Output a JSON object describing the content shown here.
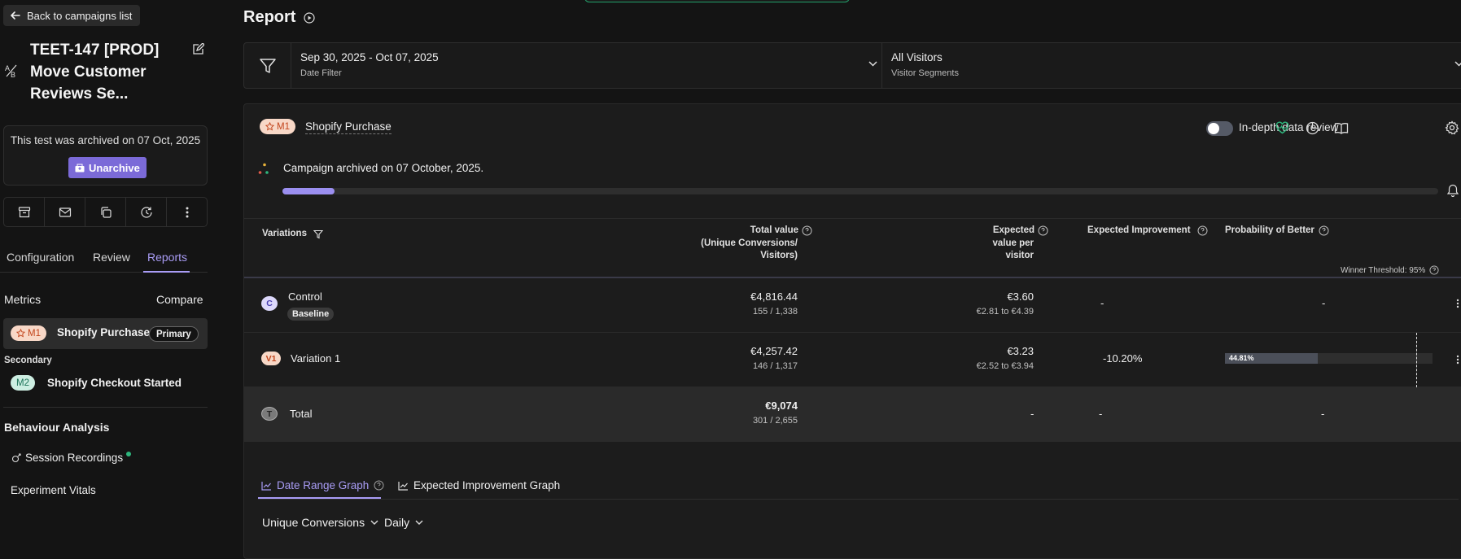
{
  "sidebar": {
    "back_label": "Back to campaigns list",
    "campaign_title_line1": "TEET-147 [PROD]",
    "campaign_title_line2": "Move Customer",
    "campaign_title_line3": "Reviews Se...",
    "archived_notice": "This test was archived on 07 Oct, 2025",
    "unarchive_label": "Unarchive",
    "tabs": [
      {
        "label": "Configuration"
      },
      {
        "label": "Review"
      },
      {
        "label": "Reports",
        "active": true
      }
    ],
    "metrics_label": "Metrics",
    "compare_label": "Compare",
    "primary_metric": {
      "badge": "M1",
      "name": "Shopify Purchase",
      "tag": "Primary"
    },
    "secondary_label": "Secondary",
    "secondary_metric": {
      "badge": "M2",
      "name": "Shopify Checkout Started"
    },
    "behaviour_label": "Behaviour Analysis",
    "session_recordings": "Session Recordings",
    "experiment_vitals": "Experiment Vitals"
  },
  "header": {
    "title": "Report"
  },
  "filters": {
    "date_range": "Sep 30, 2025 - Oct 07, 2025",
    "date_label": "Date Filter",
    "segment": "All Visitors",
    "segment_label": "Visitor Segments"
  },
  "report": {
    "metric_badge": "M1",
    "metric_name": "Shopify Purchase",
    "indepth_label": "In-depth data review",
    "archived_message": "Campaign archived on 07 October, 2025.",
    "progress_fraction": 0.045,
    "columns": {
      "variations": "Variations",
      "total_value_1": "Total value",
      "total_value_2": "(Unique Conversions/",
      "total_value_3": "Visitors)",
      "expected_1": "Expected",
      "expected_2": "value per",
      "expected_3": "visitor",
      "improvement": "Expected Improvement",
      "probability": "Probability of Better"
    },
    "winner_threshold": "Winner Threshold: 95%",
    "rows": [
      {
        "badge": "C",
        "name": "Control",
        "tag": "Baseline",
        "value": "€4,816.44",
        "ratio": "155 / 1,338",
        "expected": "€3.60",
        "range": "€2.81 to €4.39",
        "improvement": "-",
        "probability": "-"
      },
      {
        "badge": "V1",
        "name": "Variation 1",
        "value": "€4,257.42",
        "ratio": "146 / 1,317",
        "expected": "€3.23",
        "range": "€2.52 to €3.94",
        "improvement": "-10.20%",
        "probability": "44.81%",
        "probability_fraction": 0.4481
      },
      {
        "badge": "T",
        "name": "Total",
        "value": "€9,074",
        "ratio": "301 / 2,655",
        "expected": "-",
        "improvement": "-",
        "probability": "-"
      }
    ],
    "graph_tabs": [
      {
        "label": "Date Range Graph",
        "active": true
      },
      {
        "label": "Expected Improvement Graph"
      }
    ],
    "conversion_select": "Unique Conversions",
    "interval_select": "Daily"
  },
  "colors": {
    "accent": "#a99cf5",
    "unarchive": "#7b6ad8",
    "m1_badge": "#f8d8c7",
    "m2_badge": "#cdeee2"
  }
}
